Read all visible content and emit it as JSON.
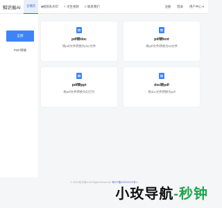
{
  "header": {
    "brand": "知识易AI",
    "nav": [
      {
        "label": "仓储页",
        "icon": "",
        "active": true
      },
      {
        "label": "■视频去水印",
        "icon": "",
        "active": false
      },
      {
        "label": "文生视频",
        "icon": "pen-icon",
        "active": false
      },
      {
        "label": "联系我们",
        "icon": "phone-icon",
        "active": false
      }
    ],
    "login": "注册",
    "register": "登录",
    "user_center": "用户中心 ▾"
  },
  "sidebar": {
    "button": "全部",
    "link": "PDF转换"
  },
  "cards": [
    {
      "title": "pdf转doc",
      "desc": "将pdf文件转换为doc文件"
    },
    {
      "title": "pdf转text",
      "desc": "将pdf文件转换为txt文件"
    },
    {
      "title": "pdf转ppt",
      "desc": "将pdf文件转换为幻灯片"
    },
    {
      "title": "doc转pdf",
      "desc": "将doc文件转换为pdf"
    }
  ],
  "footer": {
    "text": "© 2023 知识易AI All Rights Reserved",
    "icp": "粤ICP备2023XXXX号-1"
  },
  "watermark": {
    "part1": "小玫导航",
    "part2": "-秒钟"
  }
}
